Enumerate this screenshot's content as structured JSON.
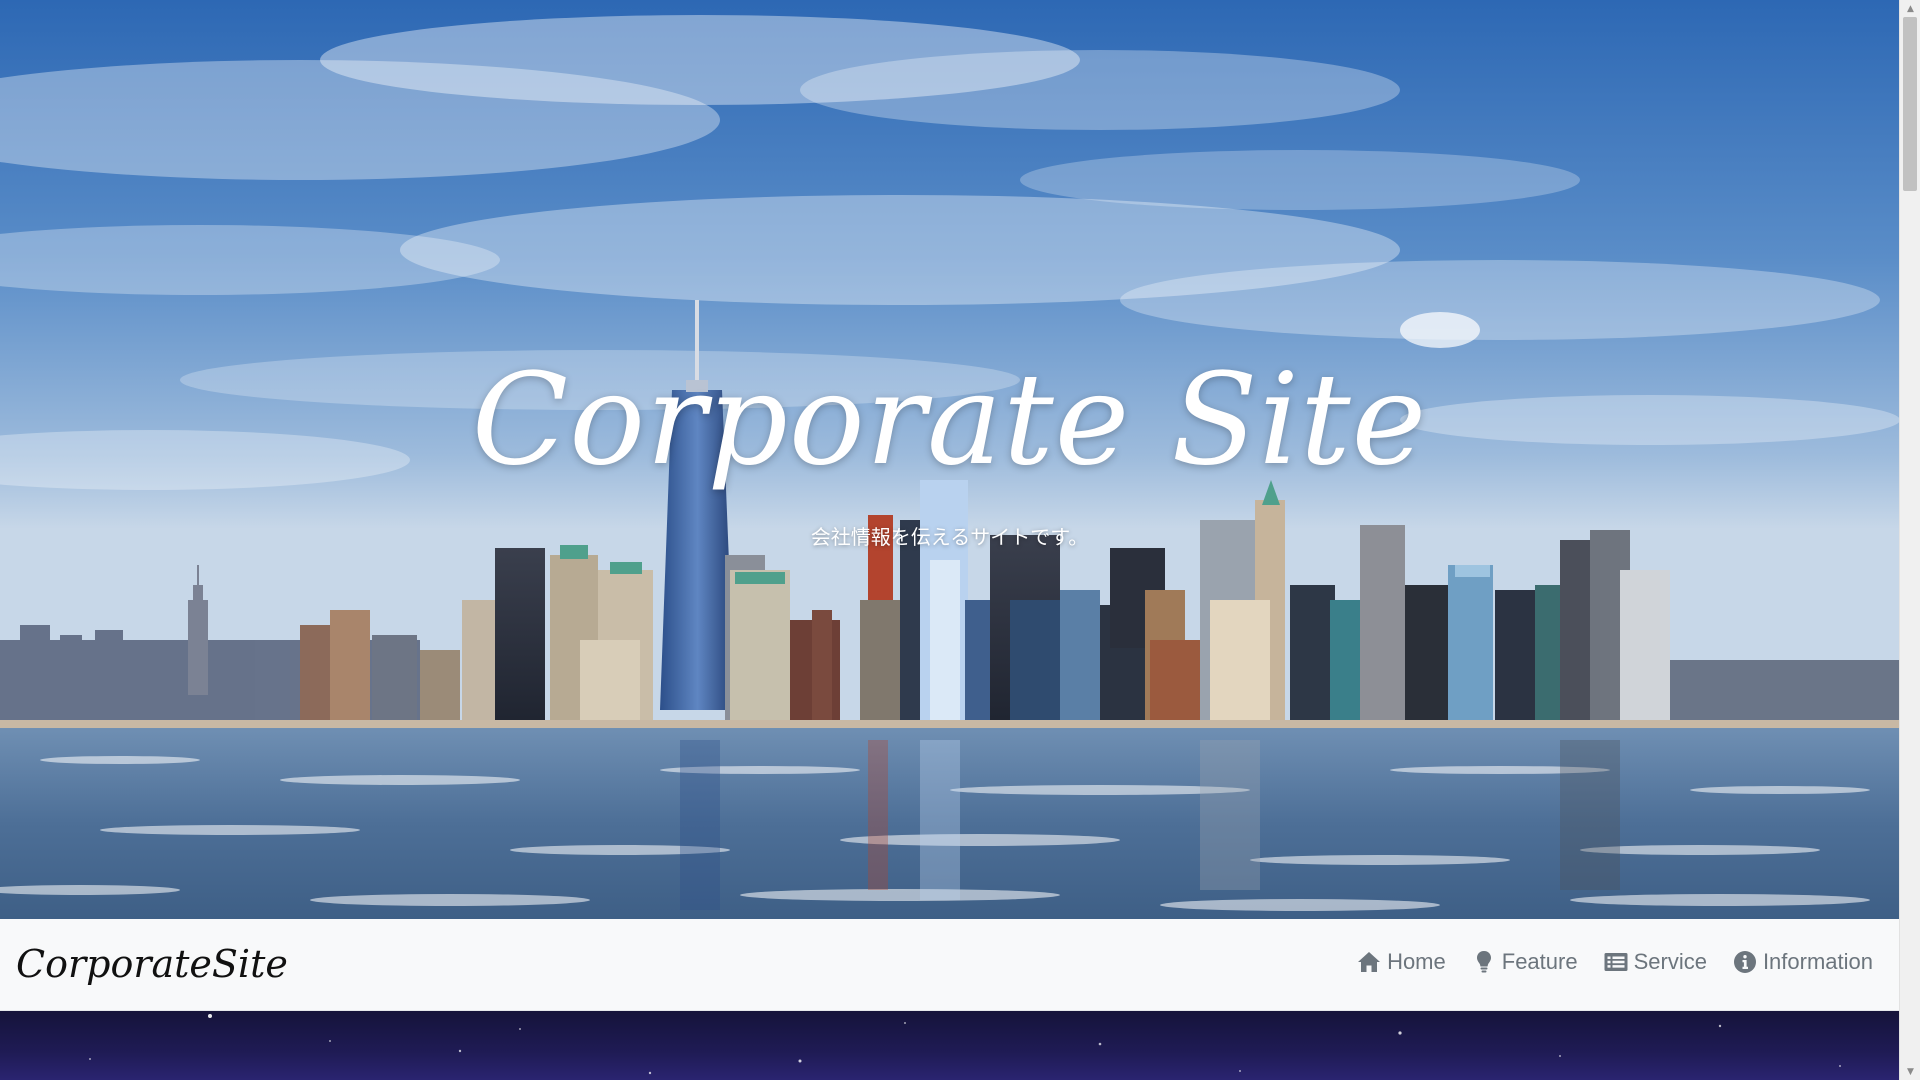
{
  "hero": {
    "title": "Corporate Site",
    "subtitle": "会社情報を伝えるサイトです。"
  },
  "navbar": {
    "brand": "CorporateSite",
    "items": [
      {
        "label": "Home",
        "icon": "home-icon"
      },
      {
        "label": "Feature",
        "icon": "lightbulb-icon"
      },
      {
        "label": "Service",
        "icon": "list-alt-icon"
      },
      {
        "label": "Information",
        "icon": "info-circle-icon"
      }
    ]
  },
  "scrollbar": {
    "up_arrow": "▲",
    "down_arrow": "▼"
  },
  "colors": {
    "navbar_bg": "#f8f9fa",
    "nav_text": "#6c757d",
    "brand_text": "#111111",
    "hero_text": "#ffffff",
    "space_bg": "#1f1b55"
  }
}
